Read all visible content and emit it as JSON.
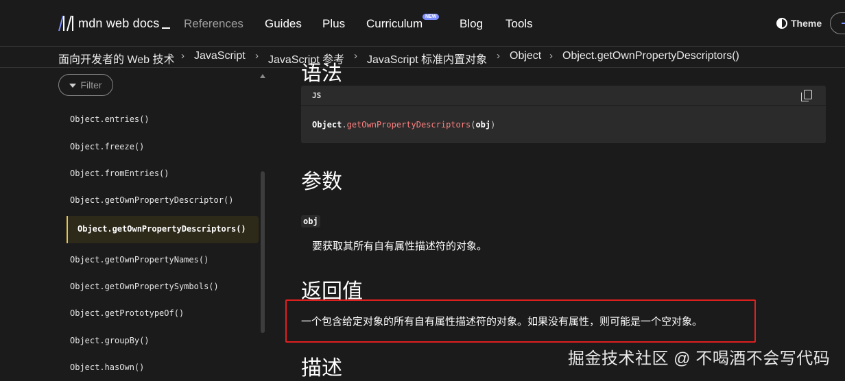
{
  "header": {
    "logo_text": "mdn web docs",
    "nav": [
      "References",
      "Guides",
      "Plus",
      "Curriculum",
      "Blog",
      "Tools"
    ],
    "new_badge": "NEW",
    "theme_label": "Theme"
  },
  "breadcrumb": [
    "面向开发者的 Web 技术",
    "JavaScript",
    "JavaScript 参考",
    "JavaScript 标准内置对象",
    "Object",
    "Object.getOwnPropertyDescriptors()"
  ],
  "sidebar": {
    "filter_placeholder": "Filter",
    "items": [
      "Object.entries()",
      "Object.freeze()",
      "Object.fromEntries()",
      "Object.getOwnPropertyDescriptor()",
      "Object.getOwnPropertyDescriptors()",
      "Object.getOwnPropertyNames()",
      "Object.getOwnPropertySymbols()",
      "Object.getPrototypeOf()",
      "Object.groupBy()",
      "Object.hasOwn()"
    ],
    "active_index": 4
  },
  "content": {
    "syntax_heading": "语法",
    "code_lang": "JS",
    "code": {
      "object": "Object",
      "dot": ".",
      "method": "getOwnPropertyDescriptors",
      "open": "(",
      "arg": "obj",
      "close": ")"
    },
    "params_heading": "参数",
    "param_name": "obj",
    "param_desc": "要获取其所有自有属性描述符的对象。",
    "return_heading": "返回值",
    "return_desc": "一个包含给定对象的所有自有属性描述符的对象。如果没有属性，则可能是一个空对象。",
    "description_heading": "描述"
  },
  "watermark": "掘金技术社区 @ 不喝酒不会写代码",
  "colors": {
    "background": "#1b1b1b",
    "accent_new": "#7d8eff",
    "active_border": "#e4c74c",
    "code_method": "#ff8080",
    "highlight_box": "#e0201f"
  }
}
